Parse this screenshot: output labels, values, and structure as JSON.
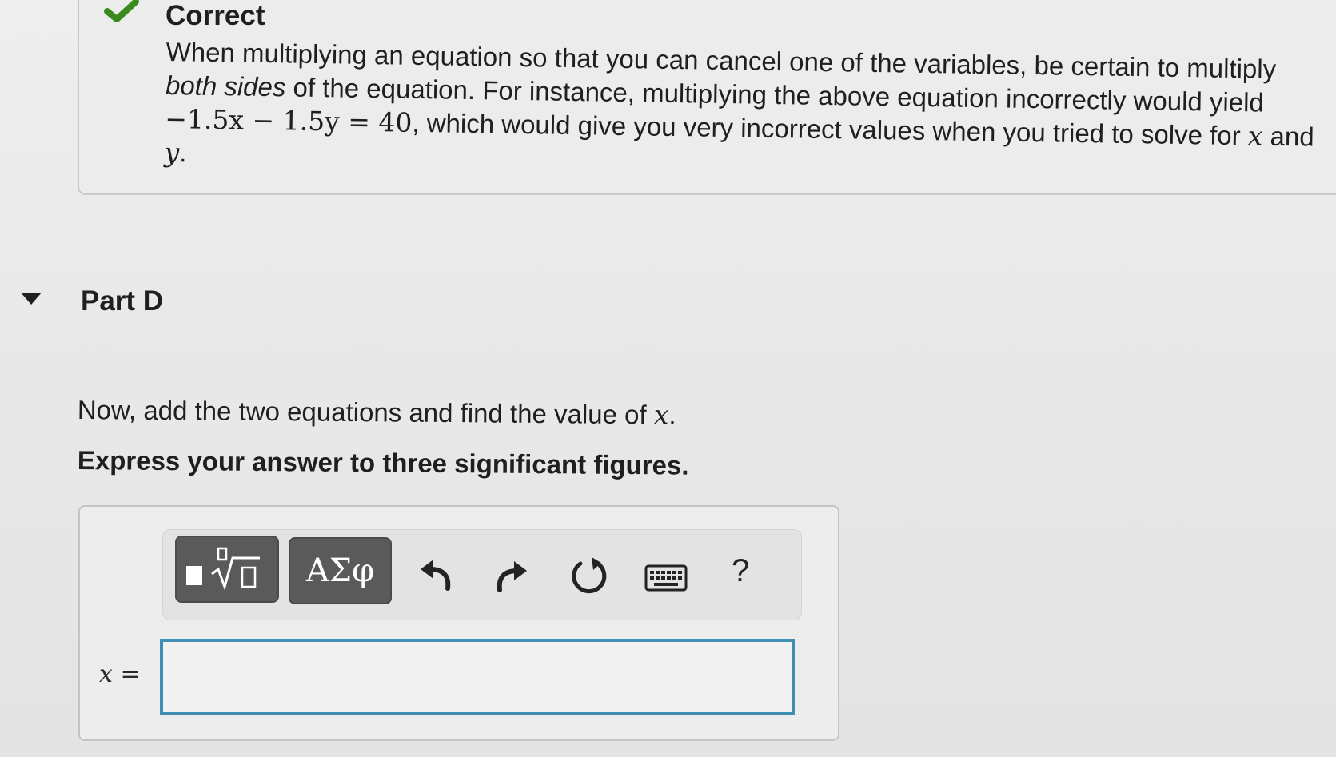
{
  "feedback": {
    "status": "Correct",
    "status_icon": "check-icon",
    "status_color": "#3b8a1e",
    "text_prefix": "When multiplying an equation so that you can cancel one of the variables, be certain to multiply ",
    "text_emphasis": "both sides",
    "text_middle": " of the equation. For instance, multiplying the above equation incorrectly would yield ",
    "equation": "−1.5x − 1.5y = 40",
    "text_after_equation": ", which would give you very incorrect values when you tried to solve for ",
    "var_x": "x",
    "text_and": " and ",
    "var_y": "y",
    "text_end": "."
  },
  "part": {
    "title": "Part D"
  },
  "question": {
    "text": "Now, add the two equations and find the value of ",
    "variable": "x",
    "end": ".",
    "instruction": "Express your answer to three significant figures."
  },
  "toolbar": {
    "greek_label": "ΑΣφ",
    "help_label": "?",
    "icons": [
      "templates-icon",
      "undo-icon",
      "redo-icon",
      "reset-icon",
      "keyboard-icon"
    ]
  },
  "answer": {
    "label_var": "x",
    "label_eq": " =",
    "value": "",
    "accent_color": "#3e8fb3"
  }
}
